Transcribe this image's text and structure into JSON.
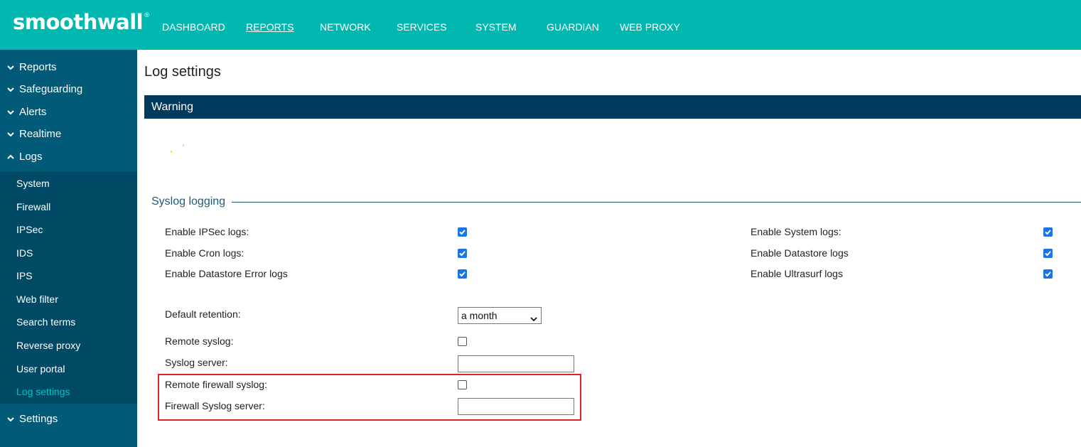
{
  "brand": {
    "name": "smoothwall",
    "mark": "®"
  },
  "topnav": {
    "items": [
      "DASHBOARD",
      "REPORTS",
      "NETWORK",
      "SERVICES",
      "SYSTEM",
      "GUARDIAN",
      "WEB PROXY"
    ],
    "active": "REPORTS"
  },
  "sidebar": {
    "groups": [
      "Reports",
      "Safeguarding",
      "Alerts",
      "Realtime",
      "Logs",
      "Settings"
    ],
    "logs_items": [
      "System",
      "Firewall",
      "IPSec",
      "IDS",
      "IPS",
      "Web filter",
      "Search terms",
      "Reverse proxy",
      "User portal",
      "Log settings"
    ],
    "active_item": "Log settings"
  },
  "main": {
    "title": "Log settings",
    "warning": "Warning",
    "section": "Syslog logging",
    "checks_left": [
      {
        "label": "Enable IPSec logs:",
        "checked": true
      },
      {
        "label": "Enable Cron logs:",
        "checked": true
      },
      {
        "label": "Enable Datastore Error logs",
        "checked": true
      }
    ],
    "checks_right": [
      {
        "label": "Enable System logs:",
        "checked": true
      },
      {
        "label": "Enable Datastore logs",
        "checked": true
      },
      {
        "label": "Enable Ultrasurf logs",
        "checked": true
      }
    ],
    "retention": {
      "label": "Default retention:",
      "value": "a month"
    },
    "remote_syslog": {
      "label": "Remote syslog:",
      "checked": false
    },
    "syslog_server": {
      "label": "Syslog server:",
      "value": ""
    },
    "remote_fw_syslog": {
      "label": "Remote firewall syslog:",
      "checked": false
    },
    "fw_syslog_server": {
      "label": "Firewall Syslog server:",
      "value": ""
    }
  },
  "colors": {
    "topbar": "#00b8b0",
    "sidebar": "#005a78",
    "sidebar_sub": "#004a66",
    "active_link": "#00c4ba",
    "warning_bar": "#003a5c",
    "checkbox": "#1a73e8",
    "highlight": "#e02424"
  }
}
